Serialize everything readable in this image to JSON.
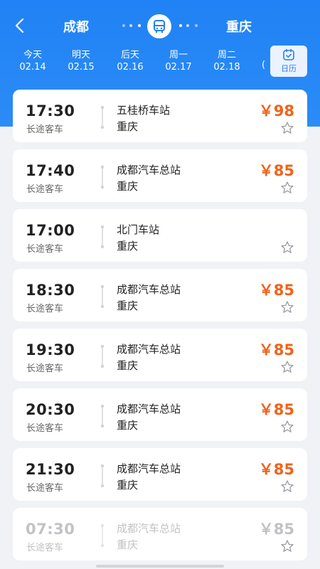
{
  "header": {
    "from_city": "成都",
    "to_city": "重庆",
    "back_icon": "chevron-left-icon",
    "bus_icon": "bus-icon",
    "accent_color": "#2082f4"
  },
  "dates": [
    {
      "weekday": "今天",
      "date": "02.14"
    },
    {
      "weekday": "明天",
      "date": "02.15"
    },
    {
      "weekday": "后天",
      "date": "02.16"
    },
    {
      "weekday": "周一",
      "date": "02.17"
    },
    {
      "weekday": "周二",
      "date": "02.18"
    }
  ],
  "date_clip": "(",
  "calendar": {
    "label": "日历",
    "icon": "calendar-icon"
  },
  "trips": [
    {
      "time": "17:30",
      "type": "长途客车",
      "departure": "五桂桥车站",
      "arrival": "重庆",
      "price": "￥98"
    },
    {
      "time": "17:40",
      "type": "长途客车",
      "departure": "成都汽车总站",
      "arrival": "重庆",
      "price": "￥85"
    },
    {
      "time": "17:00",
      "type": "长途客车",
      "departure": "北门车站",
      "arrival": "重庆",
      "price": ""
    },
    {
      "time": "18:30",
      "type": "长途客车",
      "departure": "成都汽车总站",
      "arrival": "重庆",
      "price": "￥85"
    },
    {
      "time": "19:30",
      "type": "长途客车",
      "departure": "成都汽车总站",
      "arrival": "重庆",
      "price": "￥85"
    },
    {
      "time": "20:30",
      "type": "长途客车",
      "departure": "成都汽车总站",
      "arrival": "重庆",
      "price": "￥85"
    },
    {
      "time": "21:30",
      "type": "长途客车",
      "departure": "成都汽车总站",
      "arrival": "重庆",
      "price": "￥85"
    },
    {
      "time": "07:30",
      "type": "长途客车",
      "departure": "成都汽车总站",
      "arrival": "重庆",
      "price": "￥85"
    }
  ],
  "colors": {
    "price": "#f0631b",
    "disabled": "#c2c2c6"
  }
}
